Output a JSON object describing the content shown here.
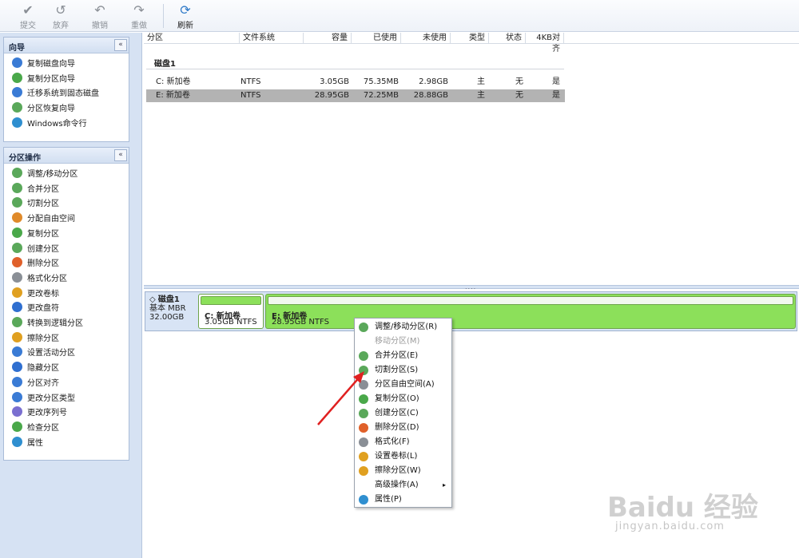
{
  "toolbar": {
    "buttons": [
      {
        "label": "提交",
        "icon": "checkmark-icon",
        "enabled": false
      },
      {
        "label": "放弃",
        "icon": "discard-icon",
        "enabled": false
      },
      {
        "label": "撤销",
        "icon": "undo-icon",
        "enabled": false
      },
      {
        "label": "重做",
        "icon": "redo-icon",
        "enabled": false
      },
      {
        "label": "刷新",
        "icon": "refresh-icon",
        "enabled": true
      }
    ]
  },
  "wizard_panel": {
    "title": "向导",
    "collapse_glyph": "«",
    "items": [
      {
        "label": "复制磁盘向导",
        "icon": "copy-disk-icon",
        "color": "#3a7bd5"
      },
      {
        "label": "复制分区向导",
        "icon": "copy-partition-icon",
        "color": "#4aa84a"
      },
      {
        "label": "迁移系统到固态磁盘",
        "icon": "migrate-os-icon",
        "color": "#3a7bd5"
      },
      {
        "label": "分区恢复向导",
        "icon": "recovery-icon",
        "color": "#5aa85a"
      },
      {
        "label": "Windows命令行",
        "icon": "command-line-icon",
        "color": "#2f8fd0"
      }
    ]
  },
  "ops_panel": {
    "title": "分区操作",
    "collapse_glyph": "«",
    "items": [
      {
        "label": "调整/移动分区",
        "icon": "resize-icon",
        "color": "#5aa85a"
      },
      {
        "label": "合并分区",
        "icon": "merge-icon",
        "color": "#5aa85a"
      },
      {
        "label": "切割分区",
        "icon": "split-icon",
        "color": "#5aa85a"
      },
      {
        "label": "分配自由空间",
        "icon": "allocate-icon",
        "color": "#e08a2a"
      },
      {
        "label": "复制分区",
        "icon": "copy-icon",
        "color": "#4aa84a"
      },
      {
        "label": "创建分区",
        "icon": "create-icon",
        "color": "#5aa85a"
      },
      {
        "label": "删除分区",
        "icon": "delete-icon",
        "color": "#e0602a"
      },
      {
        "label": "格式化分区",
        "icon": "format-icon",
        "color": "#8a8f96"
      },
      {
        "label": "更改卷标",
        "icon": "label-icon",
        "color": "#e0a020"
      },
      {
        "label": "更改盘符",
        "icon": "drive-letter-icon",
        "color": "#2f6fd0"
      },
      {
        "label": "转换到逻辑分区",
        "icon": "convert-icon",
        "color": "#5aa85a"
      },
      {
        "label": "擦除分区",
        "icon": "wipe-icon",
        "color": "#e0a020"
      },
      {
        "label": "设置活动分区",
        "icon": "set-active-icon",
        "color": "#3a7bd5"
      },
      {
        "label": "隐藏分区",
        "icon": "hide-icon",
        "color": "#2f6fd0"
      },
      {
        "label": "分区对齐",
        "icon": "align-icon",
        "color": "#3a7bd5"
      },
      {
        "label": "更改分区类型",
        "icon": "change-type-icon",
        "color": "#3a7bd5"
      },
      {
        "label": "更改序列号",
        "icon": "serial-icon",
        "color": "#7a6fd0"
      },
      {
        "label": "检查分区",
        "icon": "check-icon",
        "color": "#4aa84a"
      },
      {
        "label": "属性",
        "icon": "properties-icon",
        "color": "#2f8fd0"
      }
    ]
  },
  "table": {
    "headers": [
      "分区",
      "文件系统",
      "容量",
      "已使用",
      "未使用",
      "类型",
      "状态",
      "4KB对齐"
    ],
    "disk_label": "磁盘1",
    "rows": [
      {
        "partition": "C: 新加卷",
        "fs": "NTFS",
        "capacity": "3.05GB",
        "used": "75.35MB",
        "unused": "2.98GB",
        "type": "主",
        "status": "无",
        "aligned": "是",
        "selected": false
      },
      {
        "partition": "E: 新加卷",
        "fs": "NTFS",
        "capacity": "28.95GB",
        "used": "72.25MB",
        "unused": "28.88GB",
        "type": "主",
        "status": "无",
        "aligned": "是",
        "selected": true
      }
    ]
  },
  "disk_map": {
    "splitter_glyph": "....",
    "disk_name": "磁盘1",
    "disk_type": "基本 MBR",
    "disk_size": "32.00GB",
    "partitions": [
      {
        "name": "C: 新加卷",
        "info": "3.05GB NTFS"
      },
      {
        "name": "E: 新加卷",
        "info": "28.95GB NTFS"
      }
    ]
  },
  "context_menu": {
    "items": [
      {
        "label": "调整/移动分区(R)",
        "icon": "resize-icon",
        "color": "#5aa85a",
        "enabled": true
      },
      {
        "label": "移动分区(M)",
        "icon": "",
        "color": "",
        "enabled": false
      },
      {
        "label": "合并分区(E)",
        "icon": "merge-icon",
        "color": "#5aa85a",
        "enabled": true
      },
      {
        "label": "切割分区(S)",
        "icon": "split-icon",
        "color": "#5aa85a",
        "enabled": true
      },
      {
        "label": "分区自由空间(A)",
        "icon": "allocate-icon",
        "color": "#8a8f96",
        "enabled": true
      },
      {
        "label": "复制分区(O)",
        "icon": "copy-icon",
        "color": "#4aa84a",
        "enabled": true
      },
      {
        "label": "创建分区(C)",
        "icon": "create-icon",
        "color": "#5aa85a",
        "enabled": true
      },
      {
        "label": "删除分区(D)",
        "icon": "delete-icon",
        "color": "#e0602a",
        "enabled": true
      },
      {
        "label": "格式化(F)",
        "icon": "format-icon",
        "color": "#8a8f96",
        "enabled": true
      },
      {
        "label": "设置卷标(L)",
        "icon": "label-icon",
        "color": "#e0a020",
        "enabled": true
      },
      {
        "label": "擦除分区(W)",
        "icon": "wipe-icon",
        "color": "#e0a020",
        "enabled": true
      },
      {
        "label": "高级操作(A)",
        "icon": "",
        "color": "",
        "enabled": true,
        "submenu": true,
        "submenu_glyph": "▸"
      },
      {
        "label": "属性(P)",
        "icon": "properties-icon",
        "color": "#2f8fd0",
        "enabled": true
      }
    ]
  },
  "watermark": {
    "logo": "Baidu 经验",
    "url": "jingyan.baidu.com"
  },
  "colors": {
    "partition_fill": "#8ce05a",
    "selection": "#b3b3b3",
    "annotation_arrow": "#e02020"
  }
}
